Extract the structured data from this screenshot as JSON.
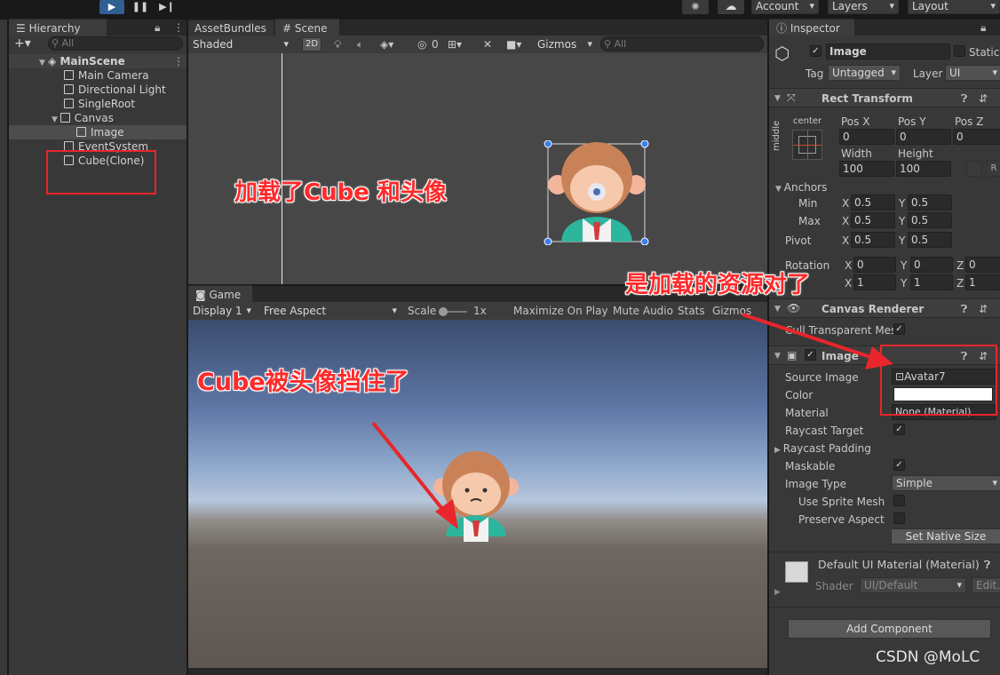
{
  "toolbar": {
    "account": "Account",
    "layers": "Layers",
    "layout": "Layout"
  },
  "hierarchy": {
    "tab": "Hierarchy",
    "search_placeholder": "All",
    "scene": "MainScene",
    "items": [
      "Main Camera",
      "Directional Light",
      "SingleRoot",
      "Canvas",
      "Image",
      "EventSystem",
      "Cube(Clone)"
    ]
  },
  "scene_view": {
    "tabs": [
      "AssetBundles",
      "Scene"
    ],
    "shading": "Shaded",
    "mode_2d": "2D",
    "hidden_count": "0",
    "gizmos": "Gizmos",
    "search_placeholder": "All"
  },
  "game_view": {
    "tab": "Game",
    "display": "Display 1",
    "aspect": "Free Aspect",
    "scale_label": "Scale",
    "scale_value": "1x",
    "maximize": "Maximize On Play",
    "mute": "Mute Audio",
    "stats": "Stats",
    "gizmos": "Gizmos"
  },
  "inspector": {
    "tab": "Inspector",
    "object_name": "Image",
    "static_label": "Static",
    "tag_label": "Tag",
    "tag_value": "Untagged",
    "layer_label": "Layer",
    "layer_value": "UI",
    "rect_transform": {
      "title": "Rect Transform",
      "anchor_h": "center",
      "anchor_v": "middle",
      "pos_x_label": "Pos X",
      "pos_y_label": "Pos Y",
      "pos_z_label": "Pos Z",
      "pos_x": "0",
      "pos_y": "0",
      "pos_z": "0",
      "width_label": "Width",
      "height_label": "Height",
      "width": "100",
      "height": "100",
      "anchors_label": "Anchors",
      "min_label": "Min",
      "max_label": "Max",
      "x": "X",
      "y": "Y",
      "z": "Z",
      "min_x": "0.5",
      "min_y": "0.5",
      "max_x": "0.5",
      "max_y": "0.5",
      "pivot_label": "Pivot",
      "pivot_x": "0.5",
      "pivot_y": "0.5",
      "rotation_label": "Rotation",
      "rot_x": "0",
      "rot_y": "0",
      "rot_z": "0",
      "scale_x": "1",
      "scale_y": "1",
      "scale_z": "1"
    },
    "canvas_renderer": {
      "title": "Canvas Renderer",
      "cull_label": "Cull Transparent Mes"
    },
    "image": {
      "title": "Image",
      "source_image_label": "Source Image",
      "source_image": "Avatar7",
      "color_label": "Color",
      "material_label": "Material",
      "material": "None (Material)",
      "raycast_target_label": "Raycast Target",
      "raycast_padding_label": "Raycast Padding",
      "maskable_label": "Maskable",
      "image_type_label": "Image Type",
      "image_type": "Simple",
      "use_sprite_mesh_label": "Use Sprite Mesh",
      "preserve_aspect_label": "Preserve Aspect",
      "set_native_size": "Set Native Size"
    },
    "material_section": {
      "title": "Default UI Material (Material)",
      "shader_label": "Shader",
      "shader": "UI/Default",
      "edit": "Edit..."
    },
    "add_component": "Add Component"
  },
  "annotations": {
    "scene_note": "加载了Cube 和头像",
    "game_note": "Cube被头像挡住了",
    "inspector_note": "是加载的资源对了",
    "color": "#ff2a2a"
  },
  "watermark": "CSDN @MoLC"
}
